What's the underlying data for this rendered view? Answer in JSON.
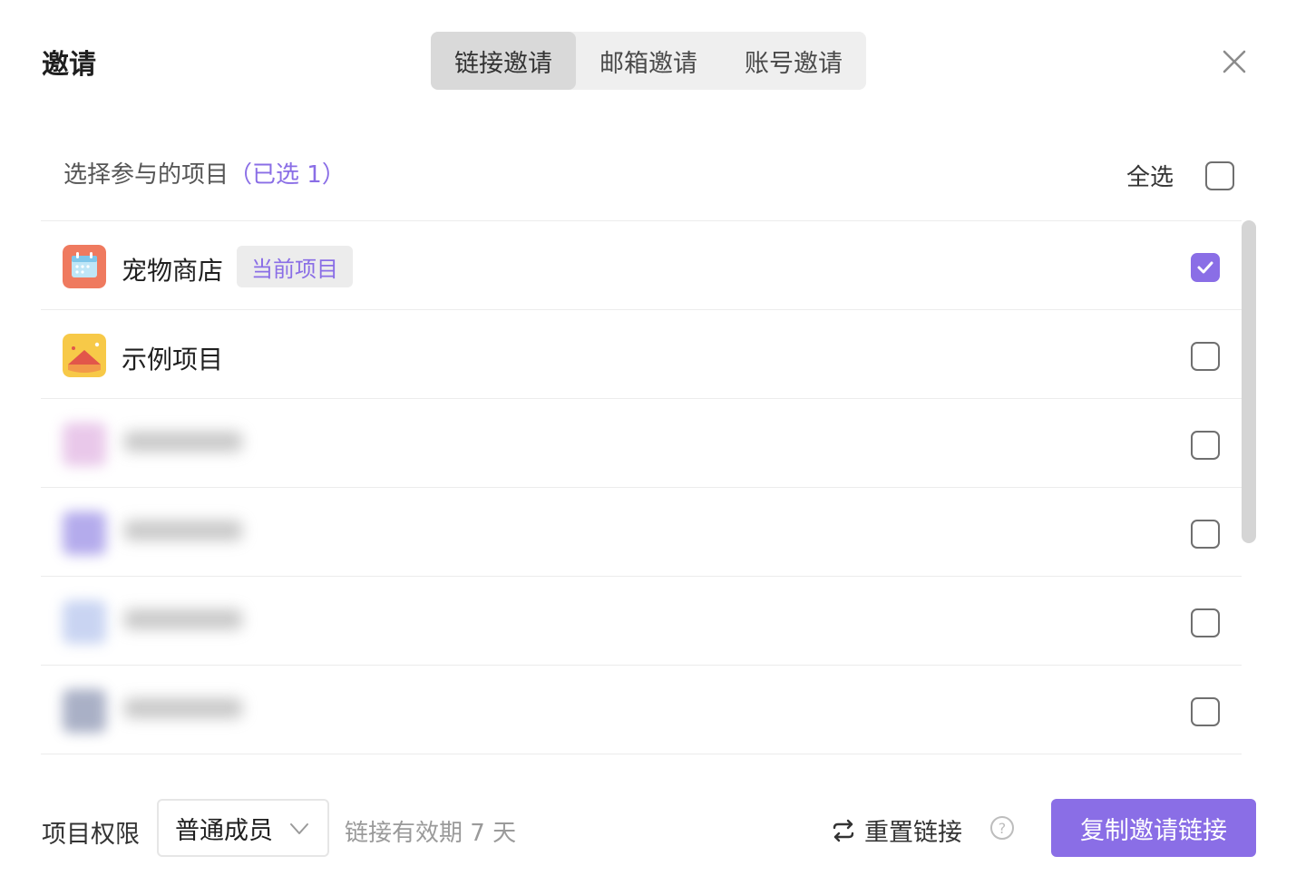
{
  "dialog": {
    "title": "邀请",
    "tabs": [
      {
        "label": "链接邀请",
        "active": true
      },
      {
        "label": "邮箱邀请",
        "active": false
      },
      {
        "label": "账号邀请",
        "active": false
      }
    ],
    "close_icon": "close-icon"
  },
  "projects": {
    "heading": "选择参与的项目",
    "selected_count_text": "（已选 1）",
    "select_all_label": "全选",
    "select_all_checked": false,
    "items": [
      {
        "name": "宠物商店",
        "tag": "当前项目",
        "icon": "calendar-icon",
        "checked": true,
        "blurred": false
      },
      {
        "name": "示例项目",
        "icon": "landscape-icon",
        "checked": false,
        "blurred": false
      },
      {
        "icon": "project-icon",
        "checked": false,
        "blurred": true
      },
      {
        "icon": "project-icon",
        "checked": false,
        "blurred": true
      },
      {
        "icon": "project-icon",
        "checked": false,
        "blurred": true
      },
      {
        "icon": "project-icon",
        "checked": false,
        "blurred": true
      }
    ]
  },
  "footer": {
    "permission_label": "项目权限",
    "role_value": "普通成员",
    "validity_text": "链接有效期 7 天",
    "reset_label": "重置链接",
    "help_glyph": "?",
    "copy_button_label": "复制邀请链接"
  },
  "colors": {
    "accent": "#8a6ee6",
    "tab_bg": "#efefef",
    "tab_active_bg": "#d9d9d9"
  }
}
